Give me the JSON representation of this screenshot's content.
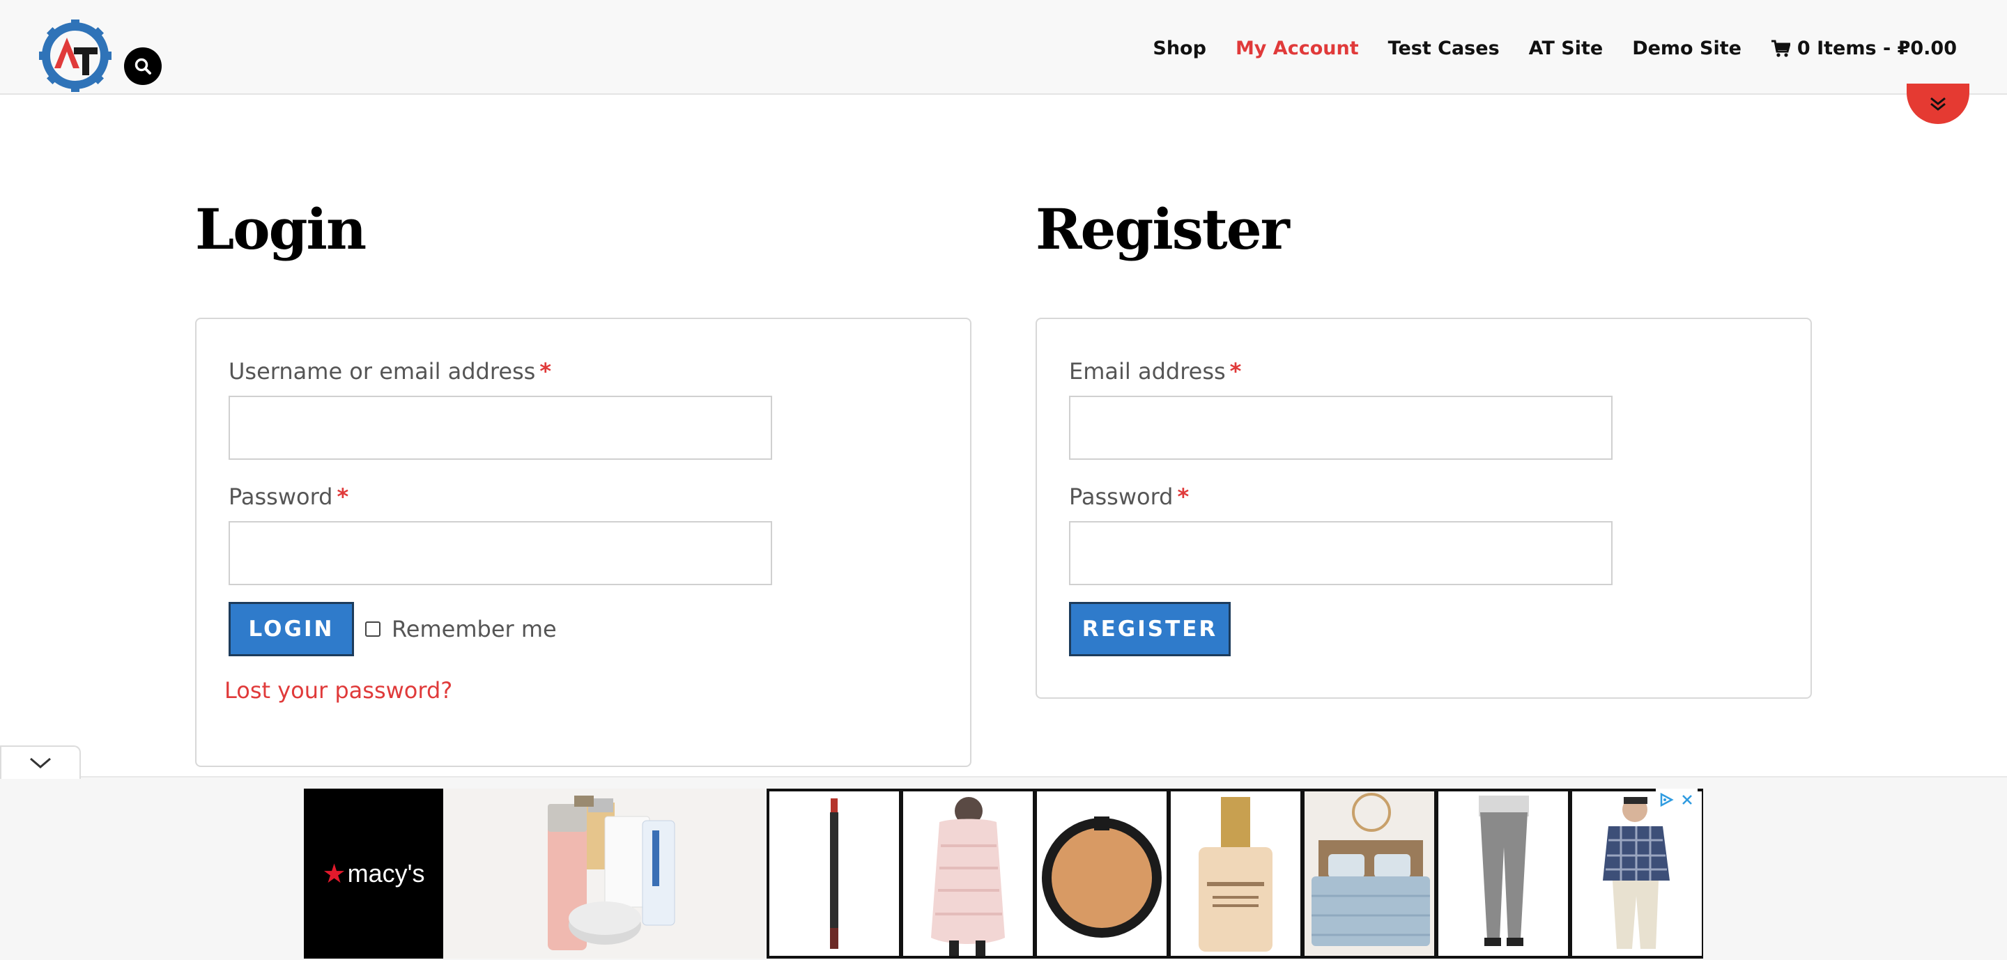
{
  "header": {
    "nav": [
      {
        "label": "Shop",
        "active": false
      },
      {
        "label": "My Account",
        "active": true
      },
      {
        "label": "Test Cases",
        "active": false
      },
      {
        "label": "AT Site",
        "active": false
      },
      {
        "label": "Demo Site",
        "active": false
      }
    ],
    "cart_label": "0 Items - ₽0.00",
    "icons": {
      "logo": "at-gear-logo",
      "search": "search-icon",
      "cart": "cart-icon",
      "scroll": "double-chevron-down-icon"
    }
  },
  "login": {
    "title": "Login",
    "username_label": "Username or email address",
    "password_label": "Password",
    "required_mark": "*",
    "username_value": "",
    "password_value": "",
    "button_label": "LOGIN",
    "remember_label": "Remember me",
    "remember_checked": false,
    "lost_password_label": "Lost your password?"
  },
  "register": {
    "title": "Register",
    "email_label": "Email address",
    "password_label": "Password",
    "required_mark": "*",
    "email_value": "",
    "password_value": "",
    "button_label": "REGISTER"
  },
  "ad": {
    "brand": "macy's",
    "brand_star": "★",
    "tiles": [
      "eyeliner-pencil",
      "pink-puffer-coat",
      "compact-powder",
      "foundation-bottle",
      "bedding-set",
      "gray-leggings",
      "plaid-shirt-model"
    ],
    "controls": [
      "adchoices-icon",
      "close-icon"
    ]
  },
  "colors": {
    "accent_red": "#e03a3a",
    "button_blue": "#2f7bcb",
    "button_border": "#1d3c5c",
    "logo_blue": "#2f73b8"
  }
}
